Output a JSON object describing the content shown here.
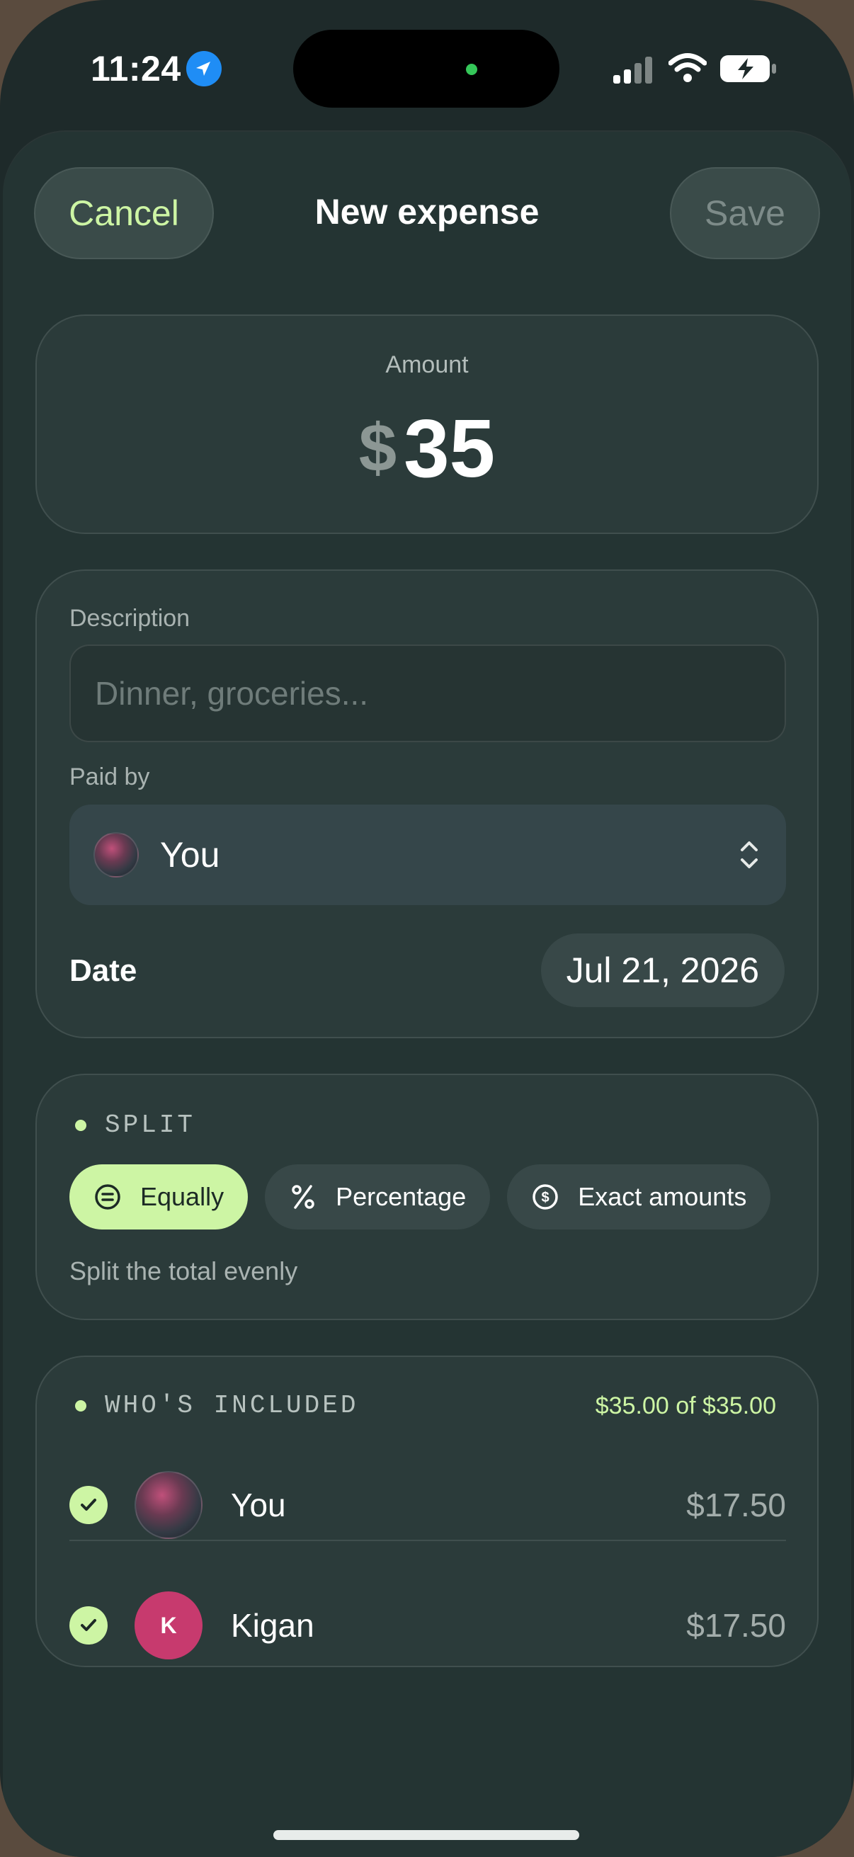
{
  "status_bar": {
    "time": "11:24"
  },
  "header": {
    "cancel_label": "Cancel",
    "title": "New expense",
    "save_label": "Save"
  },
  "amount": {
    "label": "Amount",
    "currency": "$",
    "value": "35"
  },
  "details": {
    "description_label": "Description",
    "description_placeholder": "Dinner, groceries...",
    "description_value": "",
    "paid_by_label": "Paid by",
    "paid_by_value": "You",
    "date_label": "Date",
    "date_value": "Jul 21, 2026"
  },
  "split": {
    "section_title": "SPLIT",
    "options": [
      {
        "label": "Equally",
        "icon": "equals-circle-icon",
        "selected": true
      },
      {
        "label": "Percentage",
        "icon": "percent-icon",
        "selected": false
      },
      {
        "label": "Exact amounts",
        "icon": "dollar-circle-icon",
        "selected": false
      }
    ],
    "hint": "Split the total evenly"
  },
  "included": {
    "section_title": "WHO'S INCLUDED",
    "total": "$35.00 of $35.00",
    "people": [
      {
        "name": "You",
        "amount": "$17.50",
        "checked": true,
        "avatar": "photo"
      },
      {
        "name": "Kigan",
        "initial": "K",
        "amount": "$17.50",
        "checked": true,
        "avatar": "initial",
        "avatar_color": "#c73a6e"
      }
    ]
  },
  "colors": {
    "accent": "#cdf5a4",
    "sheet_background": "#243433",
    "card_background": "#2b3b3a"
  }
}
